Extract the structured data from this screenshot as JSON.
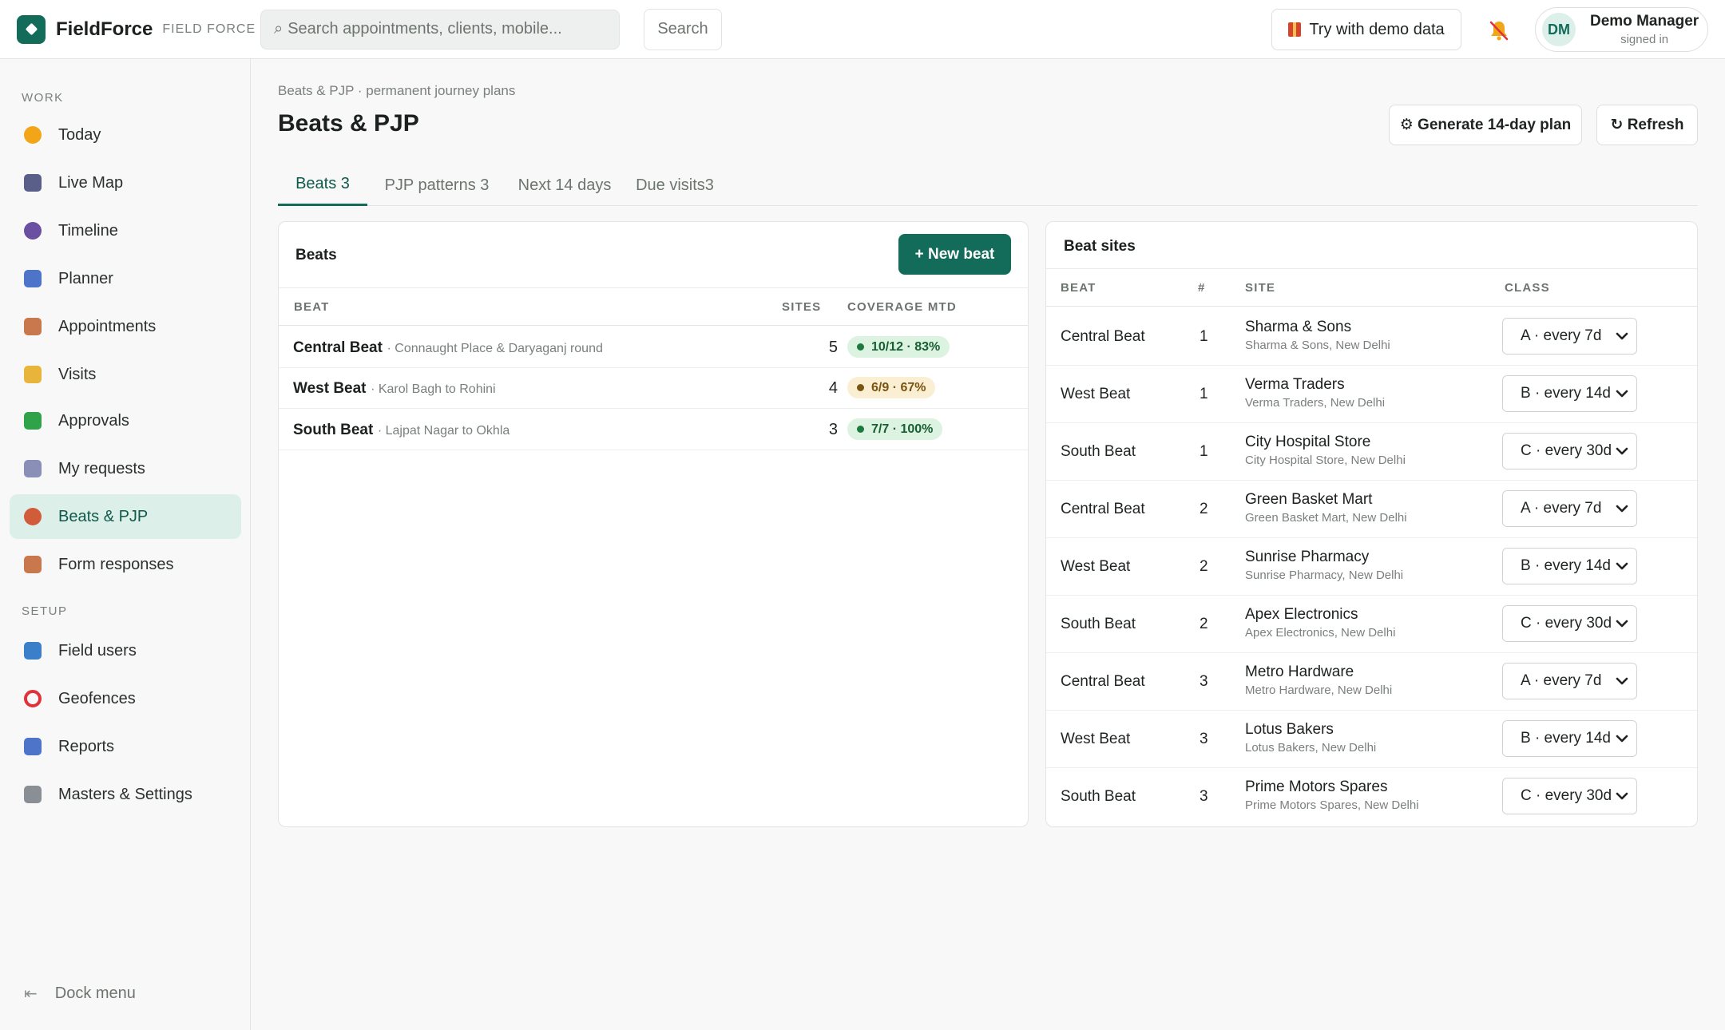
{
  "app": {
    "name": "FieldForce",
    "subtitle": "FIELD FORCE",
    "search_placeholder": "Search appointments, clients, mobile...",
    "search_button": "Search",
    "demo_button": "Try with demo data",
    "user": {
      "initials": "DM",
      "name": "Demo Manager",
      "status": "signed in"
    }
  },
  "sidebar": {
    "sections": [
      {
        "label": "WORK",
        "items": [
          {
            "label": "Today",
            "icon": "sun-icon",
            "color": "#f2a516"
          },
          {
            "label": "Live Map",
            "icon": "satellite-icon",
            "color": "#5a5f8a"
          },
          {
            "label": "Timeline",
            "icon": "stopwatch-icon",
            "color": "#6b4fa0"
          },
          {
            "label": "Planner",
            "icon": "calendar-icon",
            "color": "#4d74c9"
          },
          {
            "label": "Appointments",
            "icon": "clipboard-icon",
            "color": "#c9784d"
          },
          {
            "label": "Visits",
            "icon": "handshake-icon",
            "color": "#e8b53a"
          },
          {
            "label": "Approvals",
            "icon": "check-box-icon",
            "color": "#2fa24a"
          },
          {
            "label": "My requests",
            "icon": "receipt-icon",
            "color": "#8a8fb8"
          },
          {
            "label": "Beats & PJP",
            "icon": "compass-icon",
            "color": "#d05c3a",
            "active": true
          },
          {
            "label": "Form responses",
            "icon": "clipboard-icon",
            "color": "#c9784d"
          }
        ]
      },
      {
        "label": "SETUP",
        "items": [
          {
            "label": "Field users",
            "icon": "id-card-icon",
            "color": "#3b7fc9"
          },
          {
            "label": "Geofences",
            "icon": "ring-icon",
            "color": "#e0323a"
          },
          {
            "label": "Reports",
            "icon": "bar-chart-icon",
            "color": "#4d74c9"
          },
          {
            "label": "Masters & Settings",
            "icon": "gear-icon",
            "color": "#8a8f95"
          }
        ]
      }
    ],
    "dock_label": "Dock menu"
  },
  "page": {
    "breadcrumb": "Beats & PJP · permanent journey plans",
    "title": "Beats & PJP",
    "generate_button": "⚙ Generate 14-day plan",
    "refresh_button": "↻ Refresh",
    "tabs": [
      {
        "label": "Beats 3",
        "active": true
      },
      {
        "label": "PJP patterns 3"
      },
      {
        "label": "Next 14 days"
      },
      {
        "label": "Due visits3"
      }
    ]
  },
  "beats": {
    "title": "Beats",
    "new_button": "+ New beat",
    "columns": [
      "BEAT",
      "SITES",
      "COVERAGE MTD"
    ],
    "rows": [
      {
        "name": "Central Beat",
        "desc": "· Connaught Place & Daryaganj round",
        "sites": "5",
        "coverage": "10/12 · 83%",
        "status": "green"
      },
      {
        "name": "West Beat",
        "desc": "· Karol Bagh to Rohini",
        "sites": "4",
        "coverage": "6/9 · 67%",
        "status": "amber"
      },
      {
        "name": "South Beat",
        "desc": "· Lajpat Nagar to Okhla",
        "sites": "3",
        "coverage": "7/7 · 100%",
        "status": "green"
      }
    ]
  },
  "beat_sites": {
    "title": "Beat sites",
    "columns": [
      "BEAT",
      "#",
      "SITE",
      "CLASS"
    ],
    "rows": [
      {
        "beat": "Central Beat",
        "num": "1",
        "site": "Sharma & Sons",
        "sub": "Sharma & Sons, New Delhi",
        "class": "A · every 7d"
      },
      {
        "beat": "West Beat",
        "num": "1",
        "site": "Verma Traders",
        "sub": "Verma Traders, New Delhi",
        "class": "B · every 14d"
      },
      {
        "beat": "South Beat",
        "num": "1",
        "site": "City Hospital Store",
        "sub": "City Hospital Store, New Delhi",
        "class": "C · every 30d"
      },
      {
        "beat": "Central Beat",
        "num": "2",
        "site": "Green Basket Mart",
        "sub": "Green Basket Mart, New Delhi",
        "class": "A · every 7d"
      },
      {
        "beat": "West Beat",
        "num": "2",
        "site": "Sunrise Pharmacy",
        "sub": "Sunrise Pharmacy, New Delhi",
        "class": "B · every 14d"
      },
      {
        "beat": "South Beat",
        "num": "2",
        "site": "Apex Electronics",
        "sub": "Apex Electronics, New Delhi",
        "class": "C · every 30d"
      },
      {
        "beat": "Central Beat",
        "num": "3",
        "site": "Metro Hardware",
        "sub": "Metro Hardware, New Delhi",
        "class": "A · every 7d"
      },
      {
        "beat": "West Beat",
        "num": "3",
        "site": "Lotus Bakers",
        "sub": "Lotus Bakers, New Delhi",
        "class": "B · every 14d"
      },
      {
        "beat": "South Beat",
        "num": "3",
        "site": "Prime Motors Spares",
        "sub": "Prime Motors Spares, New Delhi",
        "class": "C · every 30d"
      }
    ]
  }
}
